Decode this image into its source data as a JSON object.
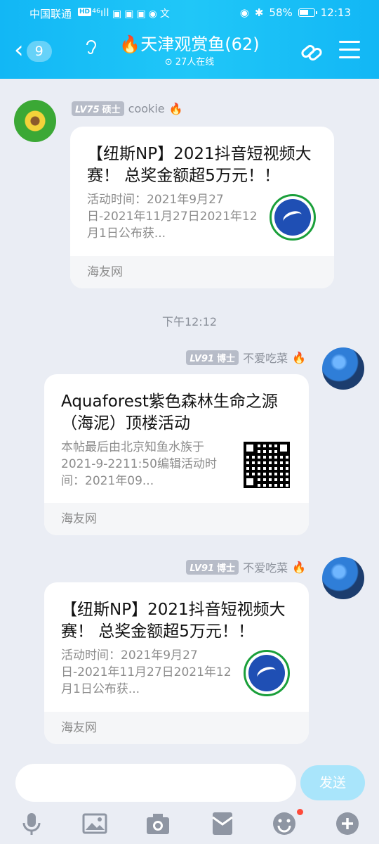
{
  "status_bar": {
    "carrier": "中国联通",
    "hd": "HD",
    "signal": "⁴⁶ıll",
    "apps": "▣▣▣◉文",
    "eye": "◉",
    "bluetooth": "✱",
    "battery": "58%",
    "time": "12:13"
  },
  "header": {
    "back_badge": "9",
    "title": "🔥天津观赏鱼(62)",
    "online": "⊙ 27人在线"
  },
  "messages": [
    {
      "level": "LV75",
      "rank": "硕士",
      "sender": "cookie",
      "card": {
        "title": "【纽斯NP】2021抖音短视频大赛！ 总奖金额超5万元！！",
        "desc": "活动时间：2021年9月27日-2021年11月27日2021年12月1日公布获...",
        "source": "海友网"
      }
    },
    {
      "level": "LV91",
      "rank": "博士",
      "sender": "不爱吃菜",
      "card": {
        "title": "Aquaforest紫色森林生命之源（海泥）顶楼活动",
        "desc": "本帖最后由北京知鱼水族于 2021-9-2211:50编辑活动时间：2021年09...",
        "source": "海友网"
      }
    },
    {
      "level": "LV91",
      "rank": "博士",
      "sender": "不爱吃菜",
      "card": {
        "title": "【纽斯NP】2021抖音短视频大赛！ 总奖金额超5万元！！",
        "desc": "活动时间：2021年9月27日-2021年11月27日2021年12月1日公布获...",
        "source": "海友网"
      }
    }
  ],
  "time_divider": "下午12:12",
  "input": {
    "placeholder": "",
    "send_label": "发送"
  },
  "toolbar": [
    "mic-icon",
    "image-icon",
    "camera-icon",
    "red-packet-icon",
    "emoji-icon",
    "plus-icon"
  ],
  "colors": {
    "header": "#12b7f5",
    "background": "#eaedf4",
    "send_disabled": "#a9e5fb"
  }
}
